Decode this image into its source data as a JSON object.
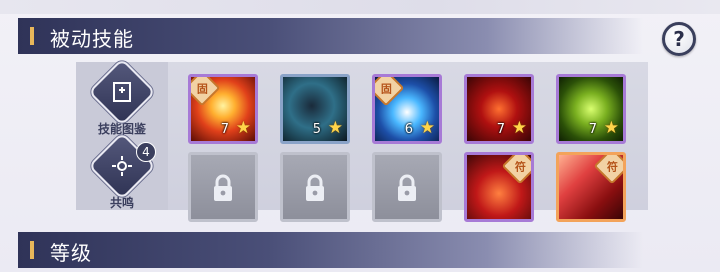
{
  "sections": {
    "passive_skills": "被动技能",
    "level": "等级"
  },
  "help_button": "?",
  "side": {
    "codex_label": "技能图鉴",
    "resonance_label": "共鸣",
    "resonance_badge": "4"
  },
  "skills": [
    {
      "level": "7",
      "tag": "固",
      "theme": "fire",
      "border": "rare"
    },
    {
      "level": "5",
      "tag": "",
      "theme": "shadow",
      "border": "common"
    },
    {
      "level": "6",
      "tag": "固",
      "theme": "vortex",
      "border": "rare"
    },
    {
      "level": "7",
      "tag": "",
      "theme": "demon",
      "border": "rare"
    },
    {
      "level": "7",
      "tag": "",
      "theme": "nature",
      "border": "rare"
    },
    {
      "level": "",
      "tag": "",
      "theme": "locked",
      "border": "locked"
    },
    {
      "level": "",
      "tag": "",
      "theme": "locked",
      "border": "locked"
    },
    {
      "level": "",
      "tag": "",
      "theme": "locked",
      "border": "locked"
    },
    {
      "level": "",
      "tag": "符",
      "theme": "demon2",
      "border": "rare"
    },
    {
      "level": "",
      "tag": "符",
      "theme": "slash",
      "border": "epic"
    }
  ],
  "colors": {
    "header_dark": "#2f3358",
    "accent_bar": "#e8b75a",
    "star": "#ffd54a",
    "rare_border": "#a77ad6",
    "epic_border": "#f3a35a"
  }
}
